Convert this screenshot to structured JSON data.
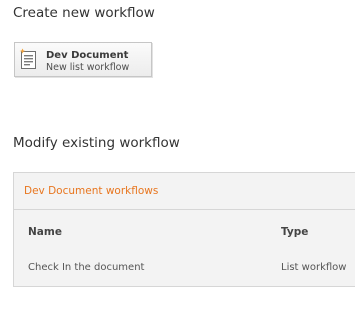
{
  "create": {
    "heading": "Create new workflow",
    "tile": {
      "title": "Dev Document",
      "subtitle": "New list workflow",
      "icon": "list-document-icon"
    }
  },
  "modify": {
    "heading": "Modify existing workflow",
    "group_title": "Dev Document workflows",
    "columns": [
      "Name",
      "Type"
    ],
    "rows": [
      {
        "name": "Check In the document",
        "type": "List workflow"
      }
    ]
  },
  "colors": {
    "accent_link": "#e8761f",
    "panel_bg": "#f3f3f3",
    "border": "#d6d6d6"
  }
}
